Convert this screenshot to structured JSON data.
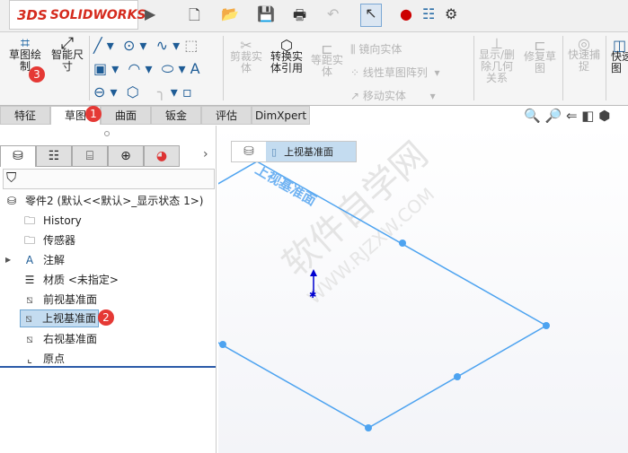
{
  "app": {
    "brand": "SOLIDWORKS",
    "brand_prefix": "3DS"
  },
  "toolbar": {
    "icons": [
      "new-document-icon",
      "open-icon",
      "save-icon",
      "print-icon",
      "undo-icon",
      "select-pointer-icon",
      "rebuild-traffic-light-icon",
      "file-properties-icon",
      "options-gear-icon"
    ]
  },
  "ribbon": {
    "sketch": "草图绘制",
    "smart_dim": "智能尺寸",
    "trim": "剪裁实体",
    "convert": "转换实体引用",
    "offset": "等距实体",
    "mirror": "镜向实体",
    "linear_pattern": "线性草图阵列",
    "move": "移动实体",
    "relations": "显示/删除几何关系",
    "repair": "修复草图",
    "quick_snap": "快速捕捉",
    "rapid": "快速草图"
  },
  "tabs": [
    {
      "label": "特征"
    },
    {
      "label": "草图",
      "active": true
    },
    {
      "label": "曲面"
    },
    {
      "label": "钣金"
    },
    {
      "label": "评估"
    },
    {
      "label": "DimXpert"
    }
  ],
  "badges": {
    "one": "1",
    "two": "2",
    "three": "3"
  },
  "tree": {
    "root": "零件2  (默认<<默认>_显示状态 1>)",
    "items": [
      {
        "label": "History",
        "icon": "history-folder-icon"
      },
      {
        "label": "传感器",
        "icon": "sensor-folder-icon"
      },
      {
        "label": "注解",
        "icon": "annotation-folder-icon"
      },
      {
        "label": "材质 <未指定>",
        "icon": "material-icon"
      },
      {
        "label": "前视基准面",
        "icon": "plane-icon"
      },
      {
        "label": "上视基准面",
        "icon": "plane-icon",
        "selected": true
      },
      {
        "label": "右视基准面",
        "icon": "plane-icon"
      },
      {
        "label": "原点",
        "icon": "origin-icon"
      }
    ]
  },
  "viewport": {
    "breadcrumb": "上视基准面",
    "plane_label": "上视基准面",
    "watermark": "软件自学网",
    "watermark_url": "WWW.RJZXW.COM",
    "plane_color": "#4da3f0"
  }
}
